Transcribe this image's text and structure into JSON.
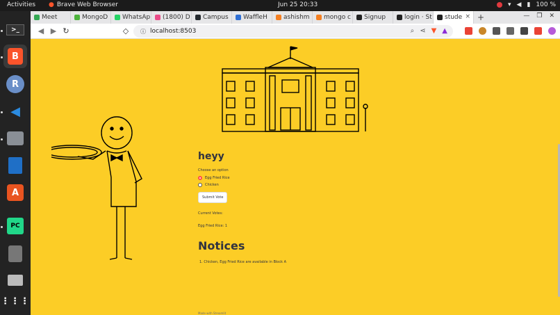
{
  "system": {
    "activities": "Activities",
    "app_name": "Brave Web Browser",
    "clock": "Jun 25  20:33",
    "battery": "100 %"
  },
  "tabs": [
    {
      "label": "Meet",
      "color": "#34a853"
    },
    {
      "label": "MongoD",
      "color": "#4db33d"
    },
    {
      "label": "WhatsAp",
      "color": "#25d366"
    },
    {
      "label": "(1800) D",
      "color": "#ea4c89"
    },
    {
      "label": "Campus",
      "color": "#24292e"
    },
    {
      "label": "WaffleH",
      "color": "#2f6fd4"
    },
    {
      "label": "ashishm",
      "color": "#f48024"
    },
    {
      "label": "mongo c",
      "color": "#f48024"
    },
    {
      "label": "Signup",
      "color": "#222222"
    },
    {
      "label": "login · St",
      "color": "#222222"
    },
    {
      "label": "stude",
      "color": "#222222"
    }
  ],
  "toolbar": {
    "url": "localhost:8503"
  },
  "app": {
    "greeting": "heyy",
    "option_label": "Choose an option",
    "options": [
      "Egg Fried Rice",
      "Chicken"
    ],
    "selected_index": 0,
    "submit_label": "Submit Vote",
    "votes_heading": "Current Votes:",
    "votes": [
      "Egg Fried Rice: 1"
    ],
    "notices_title": "Notices",
    "notices": [
      "1.  Chicken, Egg Fried Rice are available in Block A"
    ],
    "footer": "Made with Streamlit"
  }
}
